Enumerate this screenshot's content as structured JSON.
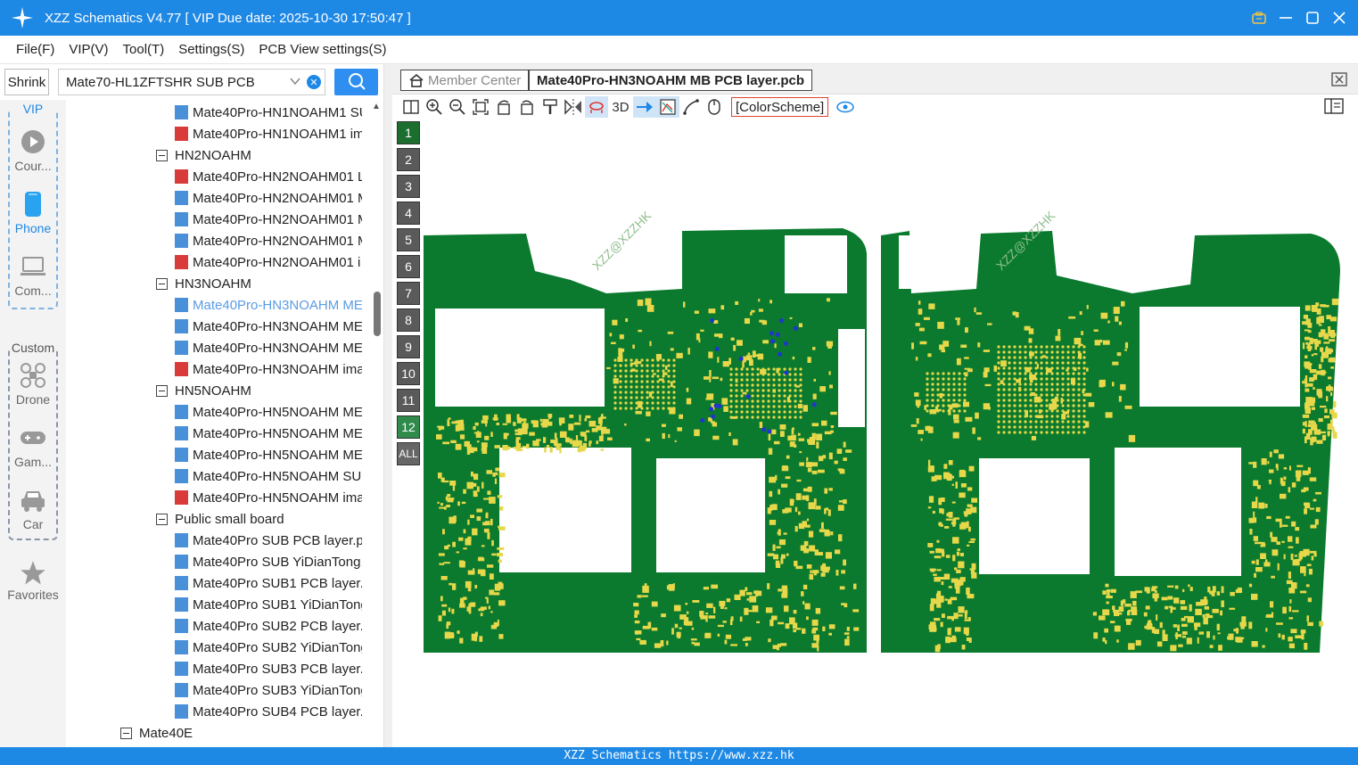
{
  "window": {
    "title": "XZZ Schematics V4.77 [ VIP Due date: 2025-10-30 17:50:47 ]"
  },
  "menu": [
    "File(F)",
    "VIP(V)",
    "Tool(T)",
    "Settings(S)",
    "PCB View settings(S)"
  ],
  "search": {
    "shrink_label": "Shrink",
    "model_value": "Mate70-HL1ZFTSHR SUB PCB"
  },
  "nav": {
    "vip_label": "VIP",
    "custom_label": "Custom",
    "items": [
      "Cour...",
      "Phone",
      "Com...",
      "Drone",
      "Gam...",
      "Car"
    ],
    "favorites": "Favorites"
  },
  "tree": [
    {
      "type": "pcb",
      "label": "Mate40Pro-HN1NOAHM1 SU"
    },
    {
      "type": "pdf",
      "label": "Mate40Pro-HN1NOAHM1 im"
    },
    {
      "type": "folder",
      "label": "HN2NOAHM"
    },
    {
      "type": "pdf",
      "label": "Mate40Pro-HN2NOAHM01 L"
    },
    {
      "type": "pcb",
      "label": "Mate40Pro-HN2NOAHM01 M"
    },
    {
      "type": "pcb",
      "label": "Mate40Pro-HN2NOAHM01 M"
    },
    {
      "type": "pcb",
      "label": "Mate40Pro-HN2NOAHM01 M"
    },
    {
      "type": "pdf",
      "label": "Mate40Pro-HN2NOAHM01 i"
    },
    {
      "type": "folder",
      "label": "HN3NOAHM"
    },
    {
      "type": "pcb",
      "label": "Mate40Pro-HN3NOAHM ME",
      "selected": true
    },
    {
      "type": "pcb",
      "label": "Mate40Pro-HN3NOAHM ME"
    },
    {
      "type": "pcb",
      "label": "Mate40Pro-HN3NOAHM ME"
    },
    {
      "type": "pdf",
      "label": "Mate40Pro-HN3NOAHM ima"
    },
    {
      "type": "folder",
      "label": "HN5NOAHM"
    },
    {
      "type": "pcb",
      "label": "Mate40Pro-HN5NOAHM ME"
    },
    {
      "type": "pcb",
      "label": "Mate40Pro-HN5NOAHM ME"
    },
    {
      "type": "pcb",
      "label": "Mate40Pro-HN5NOAHM ME"
    },
    {
      "type": "pcb",
      "label": "Mate40Pro-HN5NOAHM SUI"
    },
    {
      "type": "pdf",
      "label": "Mate40Pro-HN5NOAHM ima"
    },
    {
      "type": "folder",
      "label": "Public small board"
    },
    {
      "type": "pcb",
      "label": "Mate40Pro SUB PCB layer.pc"
    },
    {
      "type": "pcb",
      "label": "Mate40Pro SUB YiDianTong."
    },
    {
      "type": "pcb",
      "label": "Mate40Pro SUB1 PCB layer.p"
    },
    {
      "type": "pcb",
      "label": "Mate40Pro SUB1 YiDianTong"
    },
    {
      "type": "pcb",
      "label": "Mate40Pro SUB2 PCB layer.p"
    },
    {
      "type": "pcb",
      "label": "Mate40Pro SUB2 YiDianTong"
    },
    {
      "type": "pcb",
      "label": "Mate40Pro SUB3 PCB layer.p"
    },
    {
      "type": "pcb",
      "label": "Mate40Pro SUB3 YiDianTong"
    },
    {
      "type": "pcb",
      "label": "Mate40Pro SUB4 PCB layer.p"
    },
    {
      "type": "folder-top",
      "label": "Mate40E"
    }
  ],
  "tabs": {
    "member": "Member Center",
    "active": "Mate40Pro-HN3NOAHM MB PCB layer.pcb"
  },
  "toolbar": {
    "three_d": "3D",
    "color_scheme": "[ColorScheme]"
  },
  "layers": [
    "1",
    "2",
    "3",
    "4",
    "5",
    "6",
    "7",
    "8",
    "9",
    "10",
    "11",
    "12",
    "ALL"
  ],
  "layer_state": {
    "active": [
      "1"
    ],
    "semi": [
      "12"
    ]
  },
  "watermark": "XZZ@XZZHK",
  "status": "XZZ Schematics https://www.xzz.hk",
  "colors": {
    "accent": "#1e88e5",
    "board": "#0b7a2e",
    "pad": "#e6d84a",
    "layer_on": "#1b6e2e"
  }
}
